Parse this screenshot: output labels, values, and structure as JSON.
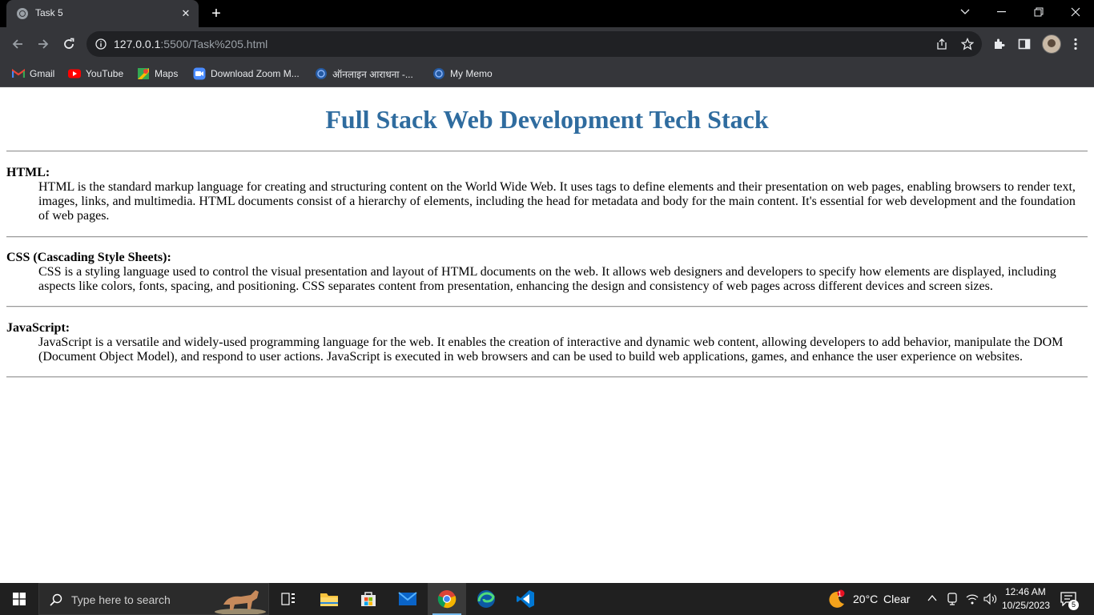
{
  "browser": {
    "tab_title": "Task 5",
    "url_host": "127.0.0.1",
    "url_rest": ":5500/Task%205.html",
    "bookmarks": [
      {
        "label": "Gmail",
        "icon": "gmail-icon"
      },
      {
        "label": "YouTube",
        "icon": "youtube-icon"
      },
      {
        "label": "Maps",
        "icon": "maps-icon"
      },
      {
        "label": "Download Zoom M...",
        "icon": "zoom-icon"
      },
      {
        "label": "ऑनलाइन आराधना -...",
        "icon": "globe-icon"
      },
      {
        "label": "My Memo",
        "icon": "globe-icon"
      }
    ]
  },
  "page": {
    "title": "Full Stack Web Development Tech Stack",
    "sections": [
      {
        "term": "HTML:",
        "description": "HTML is the standard markup language for creating and structuring content on the World Wide Web. It uses tags to define elements and their presentation on web pages, enabling browsers to render text, images, links, and multimedia. HTML documents consist of a hierarchy of elements, including the head for metadata and body for the main content. It's essential for web development and the foundation of web pages."
      },
      {
        "term": "CSS (Cascading Style Sheets):",
        "description": "CSS is a styling language used to control the visual presentation and layout of HTML documents on the web. It allows web designers and developers to specify how elements are displayed, including aspects like colors, fonts, spacing, and positioning. CSS separates content from presentation, enhancing the design and consistency of web pages across different devices and screen sizes."
      },
      {
        "term": "JavaScript:",
        "description": "JavaScript is a versatile and widely-used programming language for the web. It enables the creation of interactive and dynamic web content, allowing developers to add behavior, manipulate the DOM (Document Object Model), and respond to user actions. JavaScript is executed in web browsers and can be used to build web applications, games, and enhance the user experience on websites."
      }
    ]
  },
  "taskbar": {
    "search_placeholder": "Type here to search",
    "weather_badge": "1",
    "weather_temp": "20°C",
    "weather_condition": "Clear",
    "time": "12:46 AM",
    "date": "10/25/2023",
    "notification_count": "5"
  },
  "colors": {
    "heading": "#2f6c9f",
    "chrome_dark": "#35363a",
    "taskbar": "#202020"
  }
}
